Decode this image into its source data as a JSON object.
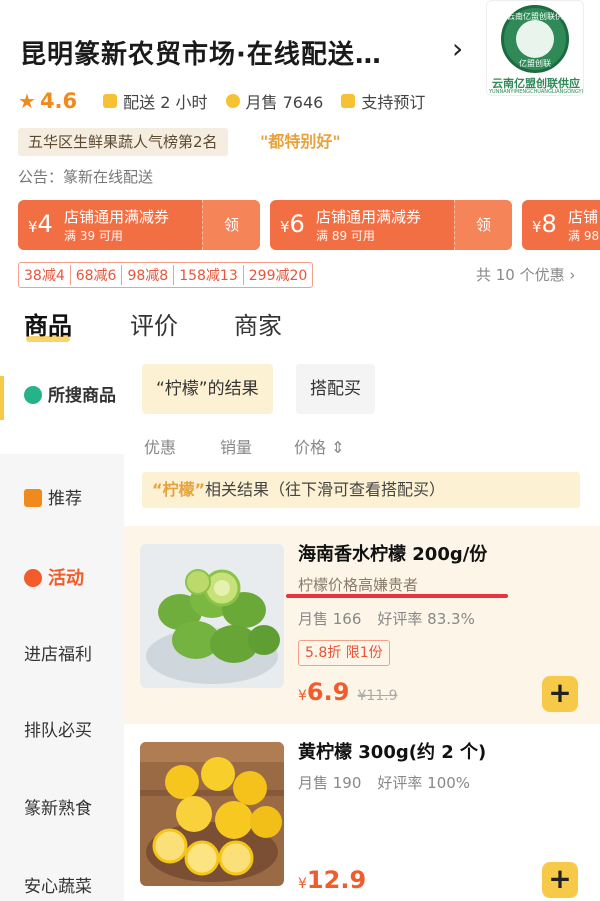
{
  "store": {
    "title": "昆明篆新农贸市场·在线配送…",
    "chevron": "›",
    "logo_seal_top": "云南亿盟创联供应",
    "logo_seal_bottom": "亿盟创联",
    "logo_caption": "云南亿盟创联供应",
    "logo_sub": "YUNNANYIMENGCHUANGLIANGONGYING",
    "rating": "4.6",
    "delivery": "配送 2 小时",
    "monthly_sales": "月售 7646",
    "preorder": "支持预订",
    "rank_badge": "五华区生鲜果蔬人气榜第2名",
    "quote": "\"都特别好\"",
    "notice": "公告：篆新在线配送"
  },
  "coupons": [
    {
      "symbol": "¥",
      "amount": "4",
      "title": "店铺通用满减券",
      "sub": "满 39 可用",
      "action": "领"
    },
    {
      "symbol": "¥",
      "amount": "6",
      "title": "店铺通用满减券",
      "sub": "满 89 可用",
      "action": "领"
    },
    {
      "symbol": "¥",
      "amount": "8",
      "title": "店铺",
      "sub": "满 98",
      "action": ""
    }
  ],
  "discounts": [
    "38减4",
    "68减6",
    "98减8",
    "158减13",
    "299减20"
  ],
  "more_offers": "共 10 个优惠 ›",
  "tabs": [
    "商品",
    "评价",
    "商家"
  ],
  "sidebar": [
    "所搜商品",
    "推荐",
    "活动",
    "进店福利",
    "排队必买",
    "篆新熟食",
    "安心蔬菜"
  ],
  "filters": {
    "result_chip": "“柠檬”的结果",
    "combo_chip": "搭配买"
  },
  "sort": [
    "优惠",
    "销量",
    "价格 ⇕"
  ],
  "banner": {
    "keyword": "“柠檬”",
    "text": "相关结果（往下滑可查看搭配买）"
  },
  "products": [
    {
      "name": "海南香水柠檬 200g/份",
      "tag": "柠檬价格高嫌贵者",
      "sales": "月售 166",
      "rating": "好评率 83.3%",
      "promo": "5.8折 限1份",
      "currency": "¥",
      "price": "6.9",
      "old_price": "¥11.9",
      "add": "+"
    },
    {
      "name": "黄柠檬 300g(约 2 个)",
      "sales": "月售 190",
      "rating": "好评率 100%",
      "currency": "¥",
      "price": "12.9",
      "add": "+"
    }
  ],
  "colors": {
    "accent": "#f7c948",
    "price": "#f25c2c",
    "coupon": "#f26f44",
    "highlight_line": "#e8323d"
  }
}
